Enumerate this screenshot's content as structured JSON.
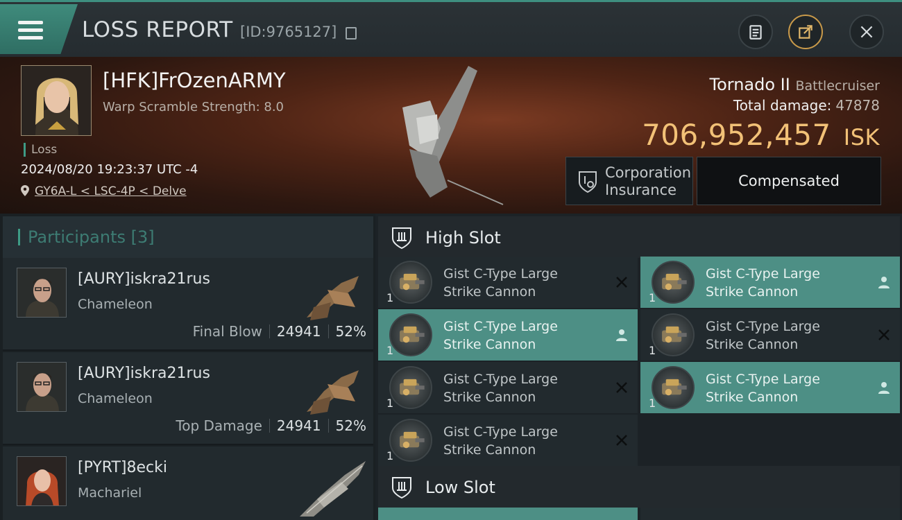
{
  "header": {
    "title": "LOSS REPORT",
    "report_id": "[ID:9765127]"
  },
  "victim": {
    "name": "[HFK]FrOzenARMY",
    "scramble": "Warp Scramble Strength: 8.0",
    "loss_label": "Loss",
    "datetime": "2024/08/20 19:23:37 UTC -4",
    "location": "GY6A-L < LSC-4P < Delve",
    "ship_name": "Tornado II",
    "ship_class": "Battlecruiser",
    "total_damage_label": "Total damage:",
    "total_damage": "47878",
    "isk_value": "706,952,457",
    "isk_unit": "ISK",
    "insurance_label_1": "Corporation",
    "insurance_label_2": "Insurance",
    "compensation_status": "Compensated"
  },
  "participants": {
    "title": "Participants",
    "count": "[3]",
    "rows": [
      {
        "name": "[AURY]iskra21rus",
        "ship": "Chameleon",
        "role": "Final Blow",
        "damage": "24941",
        "percent": "52%"
      },
      {
        "name": "[AURY]iskra21rus",
        "ship": "Chameleon",
        "role": "Top Damage",
        "damage": "24941",
        "percent": "52%"
      },
      {
        "name": "[PYRT]8ecki",
        "ship": "Machariel",
        "role": "",
        "damage": "",
        "percent": ""
      }
    ]
  },
  "high_slot": {
    "title": "High Slot",
    "modules": [
      {
        "line1": "Gist C-Type Large",
        "line2": "Strike Cannon",
        "qty": "1",
        "state": "destroyed"
      },
      {
        "line1": "Gist C-Type Large",
        "line2": "Strike Cannon",
        "qty": "1",
        "state": "dropped"
      },
      {
        "line1": "Gist C-Type Large",
        "line2": "Strike Cannon",
        "qty": "1",
        "state": "dropped"
      },
      {
        "line1": "Gist C-Type Large",
        "line2": "Strike Cannon",
        "qty": "1",
        "state": "destroyed"
      },
      {
        "line1": "Gist C-Type Large",
        "line2": "Strike Cannon",
        "qty": "1",
        "state": "destroyed"
      },
      {
        "line1": "Gist C-Type Large",
        "line2": "Strike Cannon",
        "qty": "1",
        "state": "dropped"
      },
      {
        "line1": "Gist C-Type Large",
        "line2": "Strike Cannon",
        "qty": "1",
        "state": "destroyed"
      }
    ]
  },
  "low_slot": {
    "title": "Low Slot"
  },
  "colors": {
    "accent": "#3e9b85",
    "isk": "#f2c177",
    "dropped_bg": "#4d8f85"
  },
  "icons": {
    "menu": "hamburger-icon",
    "copy": "copy-icon",
    "clipboard": "clipboard-icon",
    "share": "share-icon",
    "close": "close-icon",
    "location": "location-pin-icon",
    "insurance": "shield-insurance-icon",
    "slot": "high-slot-icon",
    "destroyed": "x-icon",
    "dropped": "person-icon"
  }
}
